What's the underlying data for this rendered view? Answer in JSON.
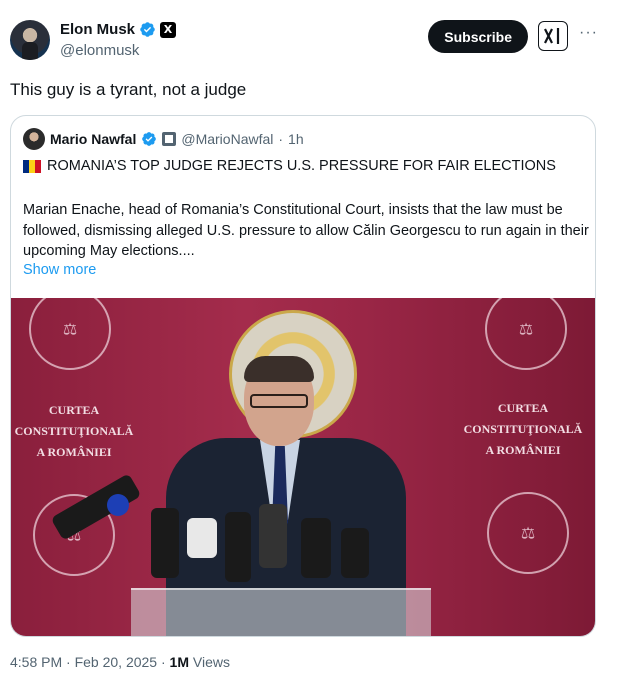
{
  "author": {
    "display_name": "Elon Musk",
    "handle": "@elonmusk",
    "badge_letter": "X"
  },
  "actions": {
    "subscribe_label": "Subscribe",
    "grok_label": "x/",
    "more_label": "···"
  },
  "tweet": {
    "text": "This guy is a tyrant, not a judge"
  },
  "quote": {
    "display_name": "Mario Nawfal",
    "handle": "@MarioNawfal",
    "separator": "·",
    "time": "1h",
    "headline": "ROMANIA’S TOP JUDGE REJECTS U.S. PRESSURE FOR FAIR ELECTIONS",
    "body": "Marian Enache, head of Romania’s Constitutional Court, insists that the law must be followed, dismissing alleged U.S. pressure to allow Călin Georgescu to run again in their upcoming May elections....",
    "show_more": "Show more",
    "flag_colors": [
      "#002b7f",
      "#fcd116",
      "#ce1126"
    ]
  },
  "photo": {
    "banner_left": "CURTEA CONSTITUŢIONALĂ\nA ROMÂNIEI",
    "banner_right": "CURTEA CONSTITUŢIONALĂ\nA ROMÂNIEI",
    "seal_text": "CONSTITUŢIONALĂ A ROMÂNIEI"
  },
  "footer": {
    "timestamp": "4:58 PM · Feb 20, 2025 · ",
    "views_count": "1M",
    "views_label": " Views"
  },
  "colors": {
    "accent": "#1d9bf0",
    "text": "#0f1419",
    "muted": "#536471",
    "border": "#cfd9de"
  }
}
